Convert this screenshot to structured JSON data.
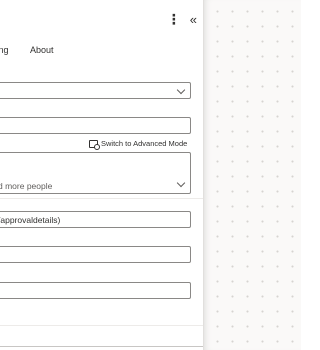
{
  "tabs": {
    "setting_label": "ting",
    "about_label": "About"
  },
  "fields": {
    "dropdown1_value": "",
    "text1_value": "",
    "assigned_to_placeholder": "d more people",
    "details_value": "/approvaldetails)",
    "text2_value": "",
    "text3_value": ""
  },
  "advanced_mode_label": "Switch to Advanced Mode",
  "icons": {
    "more": "more-options-icon",
    "collapse": "collapse-panel-icon"
  }
}
